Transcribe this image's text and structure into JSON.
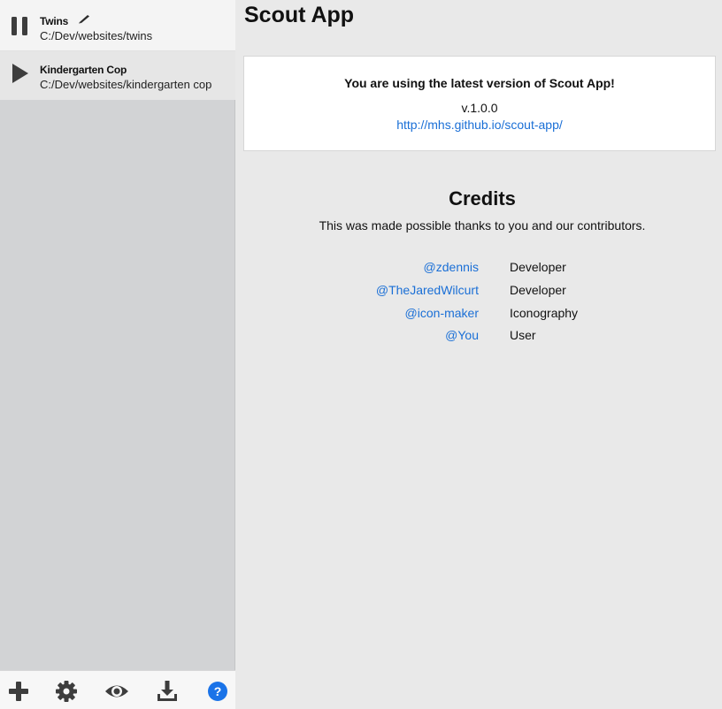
{
  "sidebar": {
    "projects": [
      {
        "name": "Twins",
        "path": "C:/Dev/websites/twins",
        "state_icon": "pause-icon",
        "edit_icon": "pencil-icon"
      },
      {
        "name": "Kindergarten Cop",
        "path": "C:/Dev/websites/kindergarten cop",
        "state_icon": "play-icon"
      }
    ],
    "toolbar": [
      "add-icon",
      "gear-icon",
      "eye-icon",
      "download-icon",
      "help-icon"
    ]
  },
  "main": {
    "title": "Scout App",
    "update": {
      "message": "You are using the latest version of Scout App!",
      "version": "v.1.0.0",
      "link": "http://mhs.github.io/scout-app/"
    },
    "credits": {
      "title": "Credits",
      "subtitle": "This was made possible thanks to you and our contributors.",
      "people": [
        {
          "handle": "@zdennis",
          "role": "Developer"
        },
        {
          "handle": "@TheJaredWilcurt",
          "role": "Developer"
        },
        {
          "handle": "@icon-maker",
          "role": "Iconography"
        },
        {
          "handle": "@You",
          "role": "User"
        }
      ]
    }
  },
  "colors": {
    "sidebar_bg": "#d2d3d5",
    "main_bg": "#e9e9e9",
    "link": "#1a6fd6",
    "help_badge": "#1a73e8",
    "icon": "#3d3d3d"
  }
}
